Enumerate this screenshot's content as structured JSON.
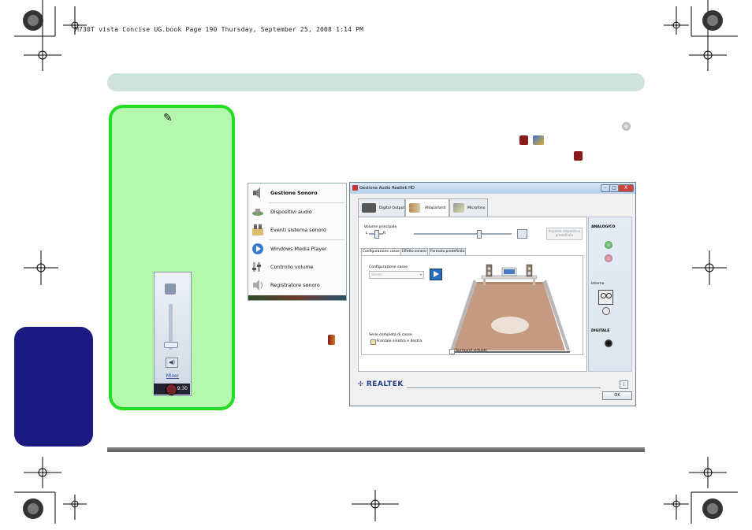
{
  "header": {
    "line": "M730T vista Concise UG.book  Page 190  Thursday, September 25, 2008  1:14 PM"
  },
  "context_menu": {
    "items": [
      {
        "label": "Gestione Sonoro",
        "bold": true,
        "icon": "speaker-icon"
      },
      {
        "label": "Dispositivi audio",
        "bold": false,
        "icon": "audio-devices-icon"
      },
      {
        "label": "Eventi sistema sonoro",
        "bold": false,
        "icon": "system-sounds-icon"
      },
      {
        "label": "Windows Media Player",
        "bold": false,
        "icon": "media-player-icon"
      },
      {
        "label": "Controllo volume",
        "bold": false,
        "icon": "volume-control-icon"
      },
      {
        "label": "Registratore sonoro",
        "bold": false,
        "icon": "sound-recorder-icon"
      }
    ]
  },
  "mixer": {
    "mute_label": "◀)",
    "link_label": "Mixer",
    "clock": "9:30"
  },
  "realtek": {
    "title": "Gestione Audio Realtek HD",
    "controls": {
      "minimize": "–",
      "maximize": "□",
      "close": "X"
    },
    "tabs": [
      {
        "label": "Digital Output",
        "icon": "digital-output-icon",
        "active": false
      },
      {
        "label": "Altoparlanti",
        "icon": "speakers-icon",
        "active": true
      },
      {
        "label": "Microfono",
        "icon": "microphone-icon",
        "active": false
      }
    ],
    "volume_label": "Volume principale",
    "balance_left": "L",
    "balance_right": "R",
    "set_default_button": "Imposta dispositivo predefinito",
    "subtabs": [
      "Configurazione casse",
      "Effetto sonoro",
      "Formato predefinito"
    ],
    "config_label": "Configurazione casse",
    "config_value": "Stereo",
    "full_range_label": "Serie completa di casse",
    "front_lr_label": "Frontale sinistra e destra",
    "surround_label": "Surround virtuale",
    "right_panel": {
      "analog_label": "ANALOGICO",
      "internal_label": "Interno",
      "digital_label": "DIGITALE"
    },
    "logo": "REALTEK",
    "info_button": "i",
    "ok_button": "OK"
  },
  "colors": {
    "note_border": "#22dd22",
    "note_fill": "#b6f7b0",
    "side_tab": "#1a1a80",
    "top_band": "#cfe3dd",
    "room_floor": "#c49a80"
  },
  "levels": {
    "mixer_volume": 0.15,
    "master_volume": 0.8,
    "balance": 0.5
  }
}
